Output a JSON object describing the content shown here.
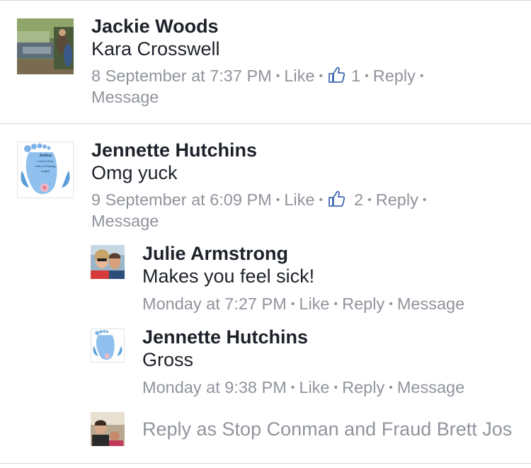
{
  "comments": [
    {
      "author": "Jackie Woods",
      "text": "Kara Crosswell",
      "time": "8 September at 7:37 PM",
      "like_label": "Like",
      "like_count": "1",
      "reply_label": "Reply",
      "message_label": "Message"
    },
    {
      "author": "Jennette Hutchins",
      "text": "Omg yuck",
      "time": "9 September at 6:09 PM",
      "like_label": "Like",
      "like_count": "2",
      "reply_label": "Reply",
      "message_label": "Message",
      "avatar_text": [
        "Joshua",
        "Love & Grow",
        "Date of Passing",
        "Angels"
      ]
    }
  ],
  "replies": [
    {
      "author": "Julie Armstrong",
      "text": "Makes you feel sick!",
      "time": "Monday at 7:27 PM",
      "like_label": "Like",
      "reply_label": "Reply",
      "message_label": "Message"
    },
    {
      "author": "Jennette Hutchins",
      "text": "Gross",
      "time": "Monday at 9:38 PM",
      "like_label": "Like",
      "reply_label": "Reply",
      "message_label": "Message"
    }
  ],
  "reply_box": {
    "placeholder": "Reply as Stop Conman and Fraud Brett Jos"
  },
  "colors": {
    "text": "#1d2129",
    "meta": "#90949c",
    "like_blue": "#4267b2",
    "divider": "#d6d7da"
  },
  "icons": [
    "thumbs-up-icon"
  ]
}
